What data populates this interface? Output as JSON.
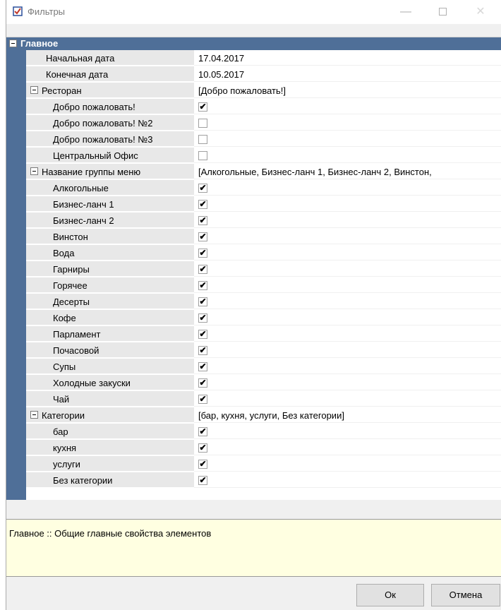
{
  "window": {
    "title": "Фильтры",
    "minimize_glyph": "—",
    "close_glyph": "✕"
  },
  "grid": {
    "category": "Главное",
    "rows": [
      {
        "type": "prop",
        "name": "Начальная дата",
        "value": "17.04.2017"
      },
      {
        "type": "prop",
        "name": "Конечная дата",
        "value": "10.05.2017"
      },
      {
        "type": "group",
        "name": "Ресторан",
        "value": "[Добро пожаловать!]"
      },
      {
        "type": "check",
        "name": "Добро пожаловать!",
        "checked": true
      },
      {
        "type": "check",
        "name": "Добро пожаловать! №2",
        "checked": false
      },
      {
        "type": "check",
        "name": "Добро пожаловать! №3",
        "checked": false
      },
      {
        "type": "check",
        "name": "Центральный Офис",
        "checked": false
      },
      {
        "type": "group",
        "name": "Название группы меню",
        "value": "[Алкогольные, Бизнес-ланч 1, Бизнес-ланч 2, Винстон,"
      },
      {
        "type": "check",
        "name": "Алкогольные",
        "checked": true
      },
      {
        "type": "check",
        "name": "Бизнес-ланч 1",
        "checked": true
      },
      {
        "type": "check",
        "name": "Бизнес-ланч 2",
        "checked": true
      },
      {
        "type": "check",
        "name": "Винстон",
        "checked": true
      },
      {
        "type": "check",
        "name": "Вода",
        "checked": true
      },
      {
        "type": "check",
        "name": "Гарниры",
        "checked": true
      },
      {
        "type": "check",
        "name": "Горячее",
        "checked": true
      },
      {
        "type": "check",
        "name": "Десерты",
        "checked": true
      },
      {
        "type": "check",
        "name": "Кофе",
        "checked": true
      },
      {
        "type": "check",
        "name": "Парламент",
        "checked": true
      },
      {
        "type": "check",
        "name": "Почасовой",
        "checked": true
      },
      {
        "type": "check",
        "name": "Супы",
        "checked": true
      },
      {
        "type": "check",
        "name": "Холодные закуски",
        "checked": true
      },
      {
        "type": "check",
        "name": "Чай",
        "checked": true
      },
      {
        "type": "group",
        "name": "Категории",
        "value": "[бар, кухня, услуги, Без категории]"
      },
      {
        "type": "check",
        "name": "бар",
        "checked": true
      },
      {
        "type": "check",
        "name": "кухня",
        "checked": true
      },
      {
        "type": "check",
        "name": "услуги",
        "checked": true
      },
      {
        "type": "check",
        "name": "Без категории",
        "checked": true
      }
    ]
  },
  "description": "Главное :: Общие главные свойства элементов",
  "buttons": {
    "ok": "Ок",
    "cancel": "Отмена"
  },
  "colors": {
    "category_bar": "#4f6f98",
    "name_cell": "#e8e8e8",
    "description_bg": "#ffffe1"
  }
}
